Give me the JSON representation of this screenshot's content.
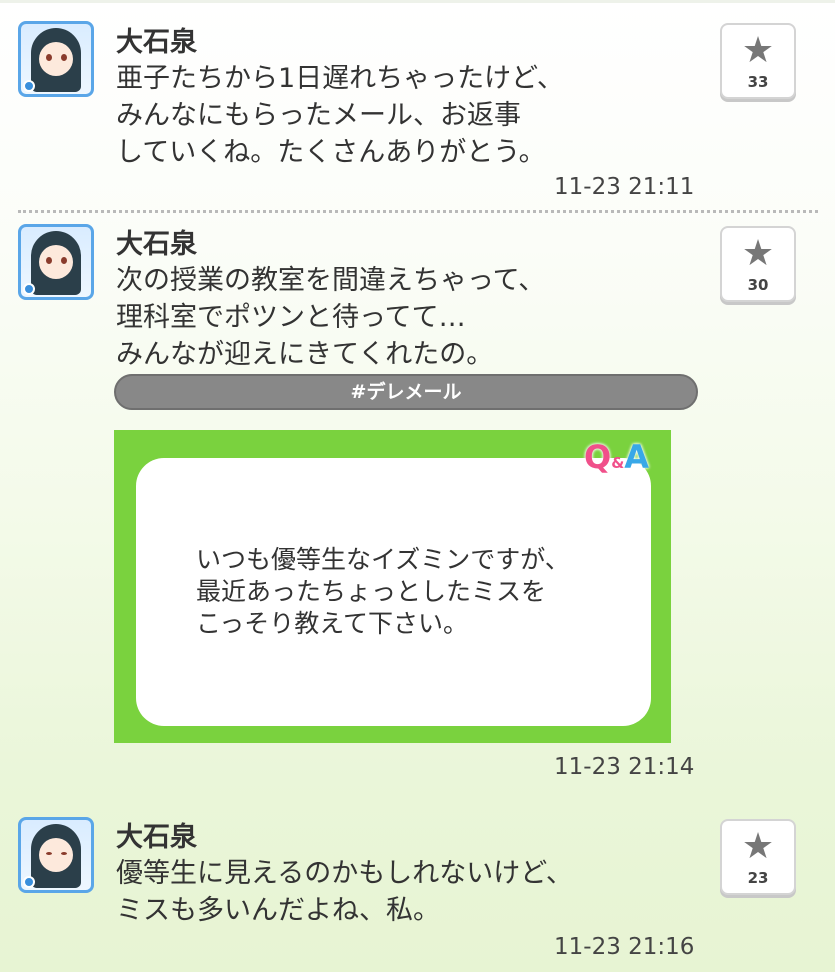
{
  "posts": [
    {
      "author": "大石泉",
      "text": "亜子たちから1日遅れちゃったけど、\nみんなにもらったメール、お返事\nしていくね。たくさんありがとう。",
      "time": "11-23 21:11",
      "stars": "33"
    },
    {
      "author": "大石泉",
      "text": "次の授業の教室を間違えちゃって、\n理科室でポツンと待ってて…\nみんなが迎えにきてくれたの。",
      "hashtag": "#デレメール",
      "qa": {
        "logo_q": "Q",
        "logo_amp": "&",
        "logo_a": "A",
        "question": "いつも優等生なイズミンですが、\n最近あったちょっとしたミスを\nこっそり教えて下さい。"
      },
      "time": "11-23 21:14",
      "stars": "30"
    },
    {
      "author": "大石泉",
      "text": "優等生に見えるのかもしれないけど、\nミスも多いんだよね、私。",
      "time": "11-23 21:16",
      "stars": "23"
    }
  ],
  "icons": {
    "star": "star-icon",
    "avatar": "avatar"
  }
}
